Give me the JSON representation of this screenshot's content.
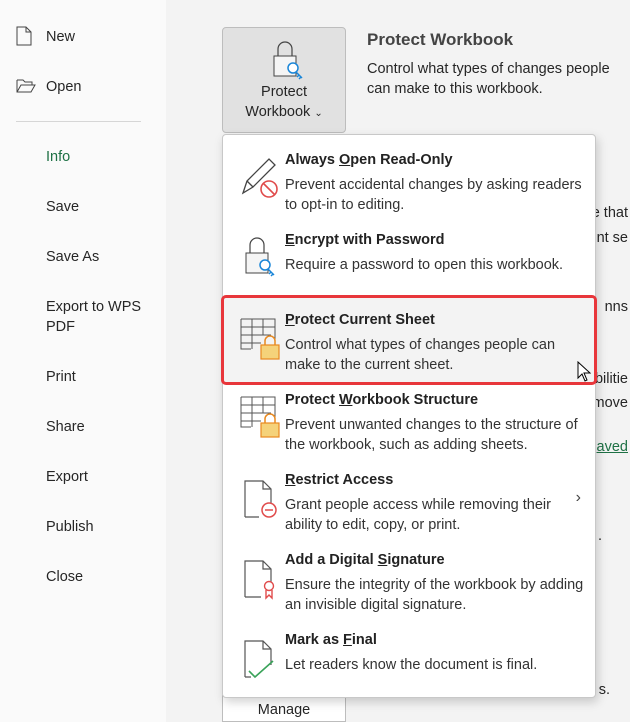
{
  "sidebar": {
    "items": [
      {
        "label": "New",
        "icon": "new-file-icon"
      },
      {
        "label": "Open",
        "icon": "folder-open-icon"
      },
      {
        "label": "Info",
        "active": true
      },
      {
        "label": "Save"
      },
      {
        "label": "Save As"
      },
      {
        "label": "Export to WPS PDF"
      },
      {
        "label": "Print"
      },
      {
        "label": "Share"
      },
      {
        "label": "Export"
      },
      {
        "label": "Publish"
      },
      {
        "label": "Close"
      }
    ]
  },
  "protect": {
    "button_line1": "Protect",
    "button_line2": "Workbook",
    "title": "Protect Workbook",
    "desc": "Control what types of changes people can make to this workbook."
  },
  "manage": {
    "label": "Manage"
  },
  "background_fragments": [
    "re that",
    "ent se",
    "nns",
    "bilitie",
    "emove",
    "aved",
    ".",
    " s."
  ],
  "menu": {
    "items": [
      {
        "pre": "Always ",
        "key": "O",
        "post": "pen Read-Only",
        "desc": "Prevent accidental changes by asking readers to opt-in to editing.",
        "icon": "pencil-prohibited-icon"
      },
      {
        "pre": "",
        "key": "E",
        "post": "ncrypt with Password",
        "desc": "Require a password to open this workbook.",
        "icon": "lock-key-icon"
      },
      {
        "pre": "",
        "key": "P",
        "post": "rotect Current Sheet",
        "desc": "Control what types of changes people can make to the current sheet.",
        "icon": "sheet-lock-icon",
        "selected": true
      },
      {
        "pre": "Protect ",
        "key": "W",
        "post": "orkbook Structure",
        "desc": "Prevent unwanted changes to the structure of the workbook, such as adding sheets.",
        "icon": "workbook-lock-icon"
      },
      {
        "pre": "",
        "key": "R",
        "post": "estrict Access",
        "desc": "Grant people access while removing their ability to edit, copy, or print.",
        "icon": "document-restrict-icon",
        "submenu": true
      },
      {
        "pre": "Add a Digital ",
        "key": "S",
        "post": "ignature",
        "desc": "Ensure the integrity of the workbook by adding an invisible digital signature.",
        "icon": "document-ribbon-icon"
      },
      {
        "pre": "Mark as ",
        "key": "F",
        "post": "inal",
        "desc": "Let readers know the document is final.",
        "icon": "document-check-icon"
      }
    ]
  },
  "colors": {
    "accent": "#1e7145",
    "highlight": "#e8363b",
    "lock": "#f5d27a"
  }
}
